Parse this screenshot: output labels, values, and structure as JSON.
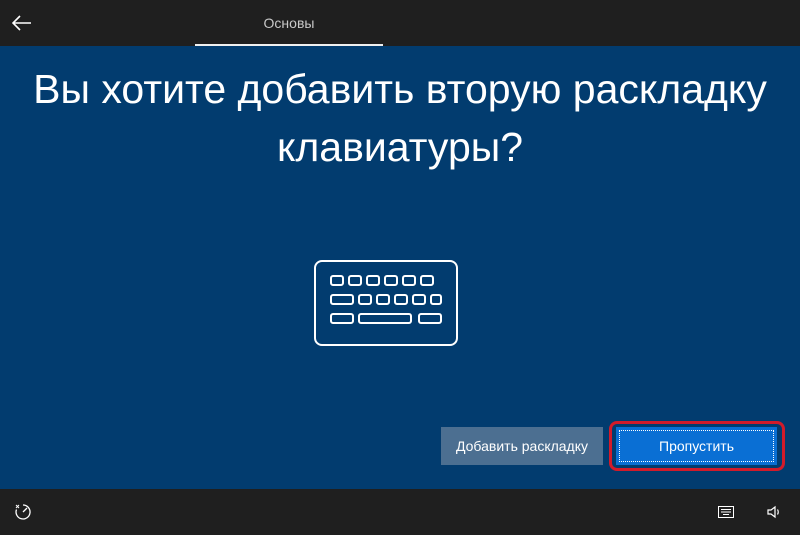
{
  "header": {
    "back_icon": "back-arrow-icon",
    "tab_label": "Основы"
  },
  "main": {
    "title_line1": "Вы хотите добавить вторую раскладку",
    "title_line2": "клавиатуры?",
    "illustration_icon": "keyboard-icon",
    "add_button_label": "Добавить раскладку",
    "skip_button_label": "Пропустить"
  },
  "footer": {
    "ease_of_access_icon": "ease-of-access-icon",
    "on_screen_keyboard_icon": "keyboard-icon",
    "volume_icon": "volume-icon"
  },
  "colors": {
    "background": "#023c6f",
    "bars": "#1f1f1f",
    "primary_button": "#0a6fd4",
    "secondary_button": "#4c6f91",
    "highlight": "#d21b2a"
  }
}
